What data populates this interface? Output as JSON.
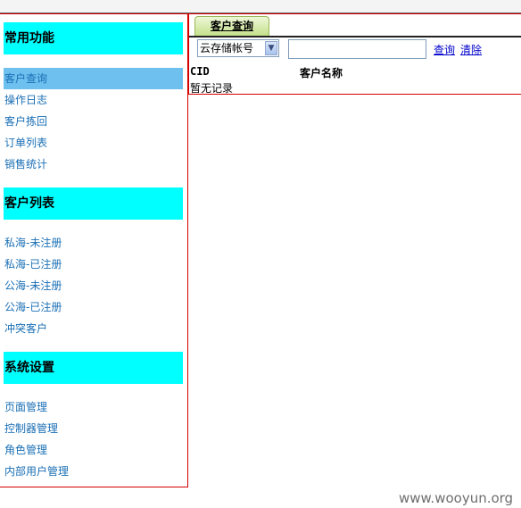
{
  "sidebar": {
    "sections": [
      {
        "title": "常用功能",
        "items": [
          "客户查询",
          "操作日志",
          "客户拣回",
          "订单列表",
          "销售统计"
        ]
      },
      {
        "title": "客户列表",
        "items": [
          "私海-未注册",
          "私海-已注册",
          "公海-未注册",
          "公海-已注册",
          "冲突客户"
        ]
      },
      {
        "title": "系统设置",
        "items": [
          "页面管理",
          "控制器管理",
          "角色管理",
          "内部用户管理"
        ]
      }
    ],
    "active_item": "客户查询"
  },
  "main": {
    "tab_label": "客户查询",
    "search": {
      "field_select": "云存储帐号",
      "input_value": "",
      "query_label": "查询",
      "clear_label": "清除"
    },
    "table": {
      "columns": [
        "CID",
        "客户名称"
      ],
      "empty_text": "暂无记录"
    }
  },
  "watermark": "www.wooyun.org",
  "colors": {
    "section_header_bg": "#00ffff",
    "active_item_bg": "#6ec0ef",
    "nav_link": "#1a6fb5",
    "border_red": "#d40000"
  }
}
